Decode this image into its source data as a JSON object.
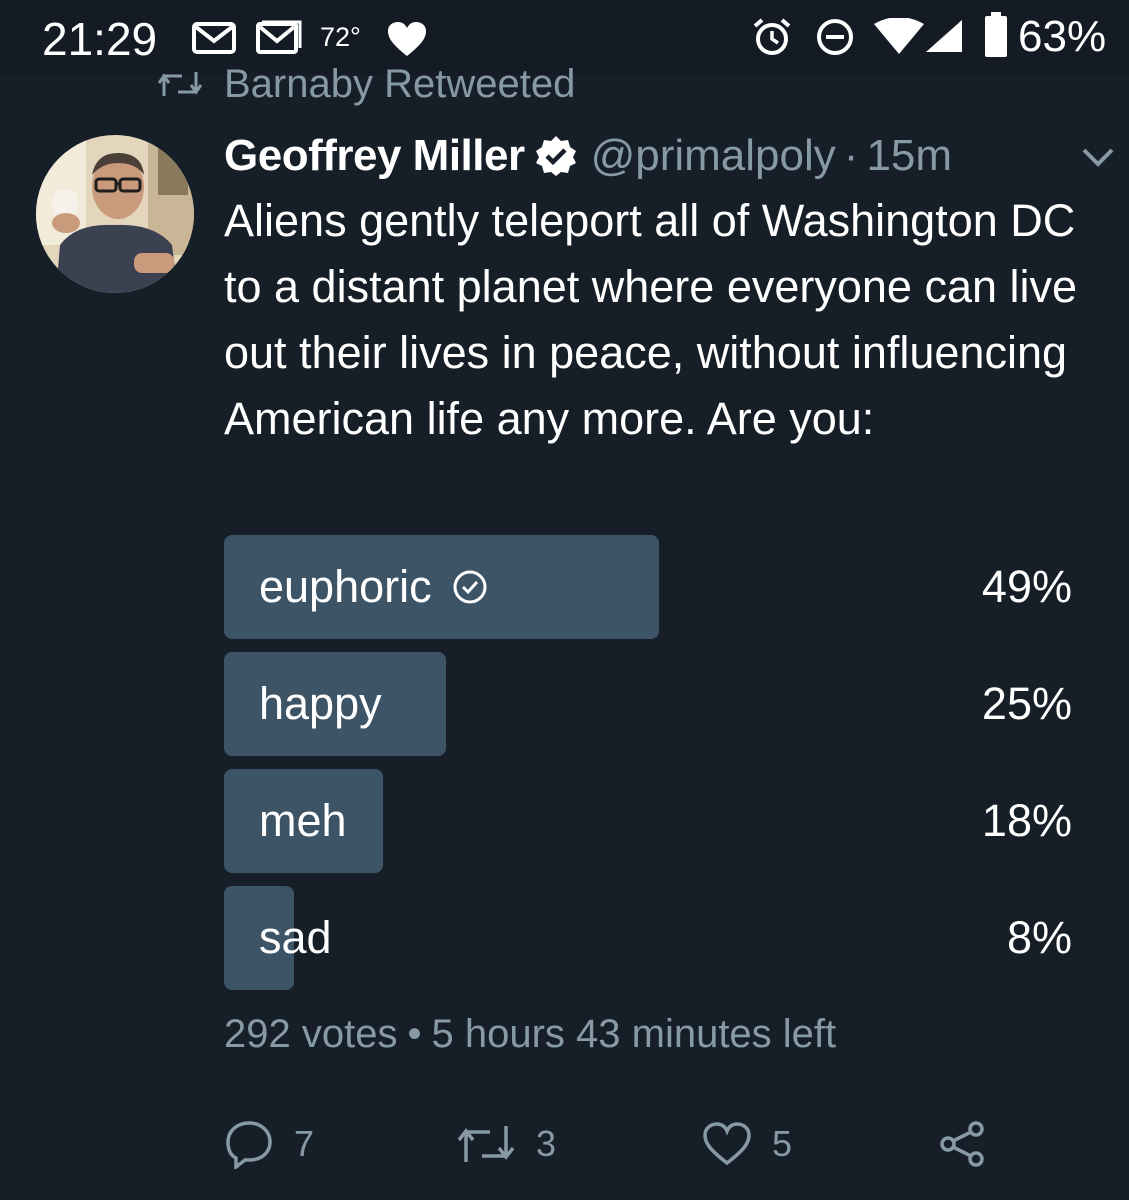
{
  "status_bar": {
    "time": "21:29",
    "temperature": "72°",
    "battery": "63%",
    "icons": [
      "gmail-icon",
      "gmail-outline-icon",
      "heart-icon",
      "alarm-icon",
      "do-not-disturb-icon",
      "wifi-icon",
      "cell-signal-icon",
      "battery-icon"
    ]
  },
  "retweet_header": {
    "icon": "retweet-icon",
    "label": "Barnaby Retweeted"
  },
  "tweet": {
    "author_name": "Geoffrey Miller",
    "verified": true,
    "handle": "@primalpoly",
    "separator": "·",
    "age": "15m",
    "text": "Aliens gently teleport all of Washington DC to a distant planet where everyone can live out their lives in peace, without influencing American life any more. Are you:",
    "menu_icon": "chevron-down-icon"
  },
  "poll": {
    "options": [
      {
        "label": "euphoric",
        "percent_text": "49%",
        "percent": 49,
        "selected": true
      },
      {
        "label": "happy",
        "percent_text": "25%",
        "percent": 25,
        "selected": false
      },
      {
        "label": "meh",
        "percent_text": "18%",
        "percent": 18,
        "selected": false
      },
      {
        "label": "sad",
        "percent_text": "8%",
        "percent": 8,
        "selected": false
      }
    ],
    "votes": "292 votes",
    "dot": "•",
    "time_left": "5 hours 43 minutes left"
  },
  "actions": {
    "reply_count": "7",
    "retweet_count": "3",
    "like_count": "5"
  },
  "colors": {
    "background": "#161e28",
    "poll_bar": "#3d5467",
    "secondary_text": "#8899a6"
  }
}
